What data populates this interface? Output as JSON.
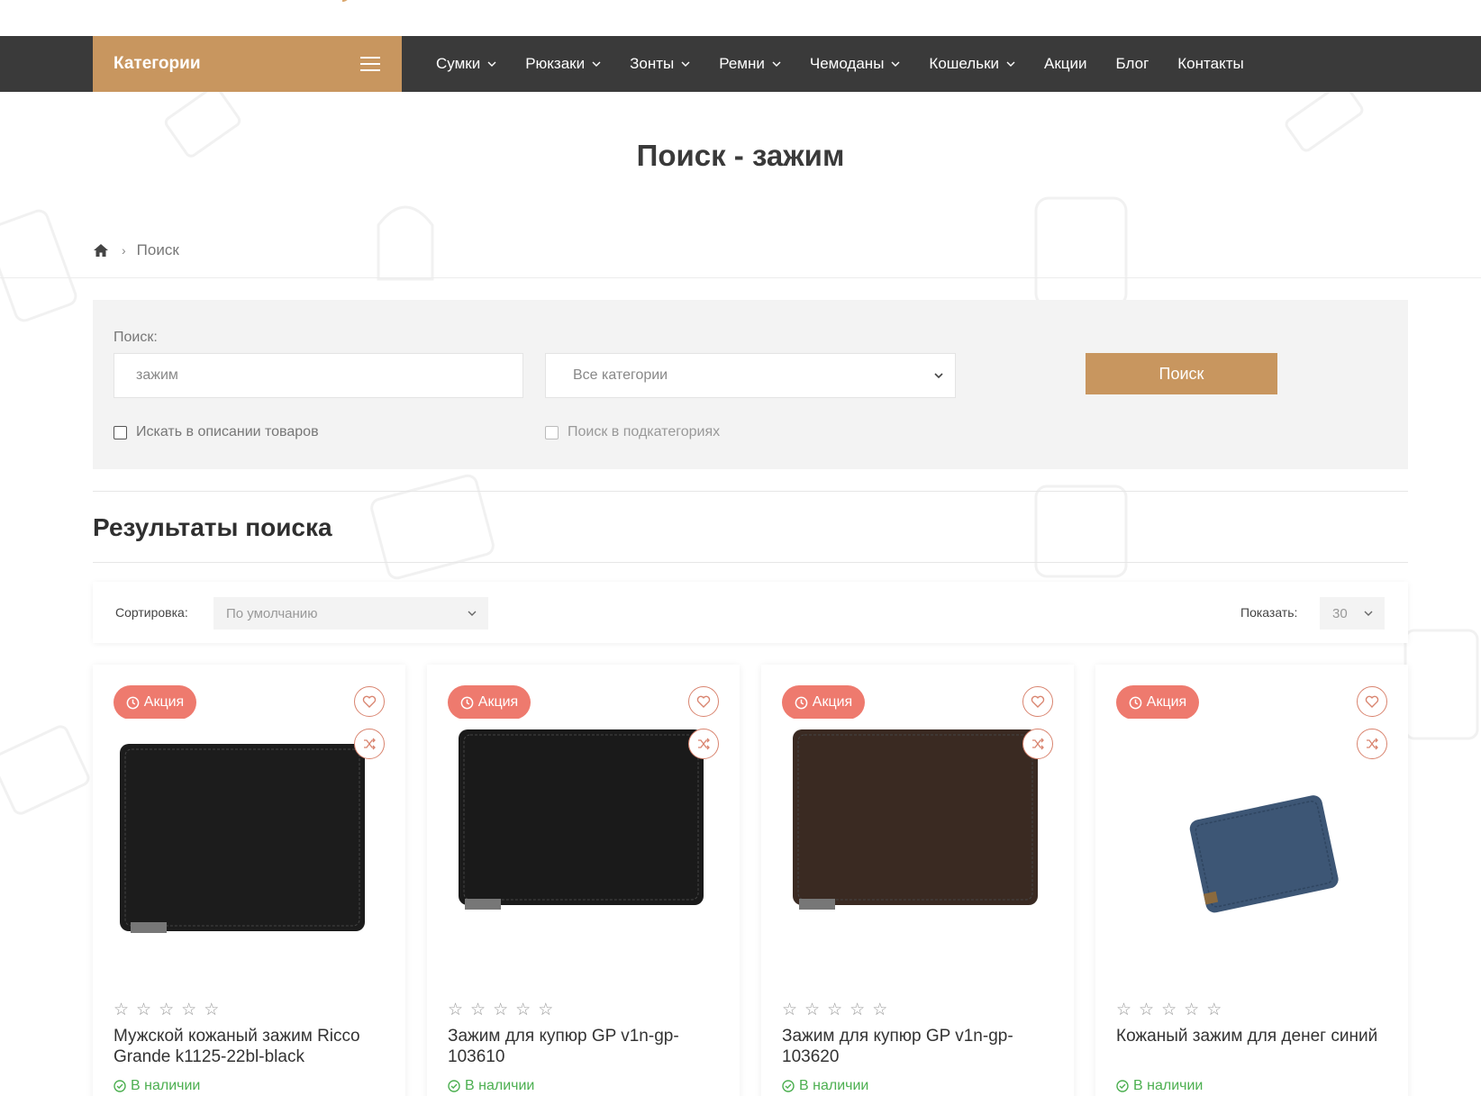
{
  "nav": {
    "categories_label": "Категории",
    "items": [
      {
        "label": "Сумки",
        "has_dropdown": true
      },
      {
        "label": "Рюкзаки",
        "has_dropdown": true
      },
      {
        "label": "Зонты",
        "has_dropdown": true
      },
      {
        "label": "Ремни",
        "has_dropdown": true
      },
      {
        "label": "Чемоданы",
        "has_dropdown": true
      },
      {
        "label": "Кошельки",
        "has_dropdown": true
      },
      {
        "label": "Акции",
        "has_dropdown": false
      },
      {
        "label": "Блог",
        "has_dropdown": false
      },
      {
        "label": "Контакты",
        "has_dropdown": false
      }
    ]
  },
  "page_title": "Поиск - зажим",
  "breadcrumb": {
    "current": "Поиск"
  },
  "search": {
    "label": "Поиск:",
    "query": "зажим",
    "category_selected": "Все категории",
    "button_label": "Поиск",
    "check_description": "Искать в описании товаров",
    "check_subcategories": "Поиск в подкатегориях"
  },
  "results": {
    "title": "Результаты поиска",
    "sort_label": "Сортировка:",
    "sort_selected": "По умолчанию",
    "show_label": "Показать:",
    "show_selected": "30"
  },
  "products": [
    {
      "badge": "Акция",
      "name": "Мужской кожаный зажим Ricco Grande k1125-22bl-black",
      "stock": "В наличии",
      "color": "#1c1c1c"
    },
    {
      "badge": "Акция",
      "name": "Зажим для купюр GP v1n-gp-103610",
      "stock": "В наличии",
      "color": "#1a1a1a"
    },
    {
      "badge": "Акция",
      "name": "Зажим для купюр GP v1n-gp-103620",
      "stock": "В наличии",
      "color": "#3a2a22"
    },
    {
      "badge": "Акция",
      "name": "Кожаный зажим для денег синий",
      "stock": "В наличии",
      "color": "#3d5675"
    }
  ],
  "colors": {
    "accent": "#c8965f",
    "navbar": "#3a3a3a",
    "sale_badge": "#ee7a6e",
    "in_stock": "#4caf50"
  }
}
